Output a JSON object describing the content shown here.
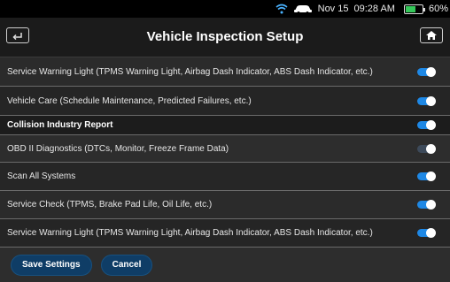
{
  "status_bar": {
    "date": "Nov 15",
    "time": "09:28 AM",
    "battery_percent": "60%",
    "battery_level": 0.6,
    "icons": [
      "wifi-icon",
      "car-icon",
      "battery-icon"
    ]
  },
  "header": {
    "title": "Vehicle Inspection Setup",
    "back_icon": "back-arrow-icon",
    "home_icon": "home-icon"
  },
  "rows": [
    {
      "label": "Service Warning Light (TPMS Warning Light, Airbag Dash Indicator, ABS Dash Indicator, etc.)",
      "enabled": true
    },
    {
      "label": "Vehicle Care (Schedule Maintenance, Predicted Failures, etc.)",
      "enabled": true
    },
    {
      "label": "Collision Industry Report",
      "enabled": true,
      "section": true
    },
    {
      "label": "OBD II Diagnostics (DTCs, Monitor, Freeze Frame Data)",
      "enabled": false
    },
    {
      "label": "Scan All Systems",
      "enabled": true
    },
    {
      "label": "Service Check (TPMS, Brake Pad Life, Oil Life, etc.)",
      "enabled": true
    },
    {
      "label": "Service Warning Light (TPMS Warning Light, Airbag Dash Indicator, ABS Dash Indicator, etc.)",
      "enabled": true
    }
  ],
  "footer": {
    "save_label": "Save Settings",
    "cancel_label": "Cancel"
  },
  "colors": {
    "toggle_on": "#1e88e5",
    "button_bg": "#0f3d66",
    "battery": "#34c759"
  }
}
